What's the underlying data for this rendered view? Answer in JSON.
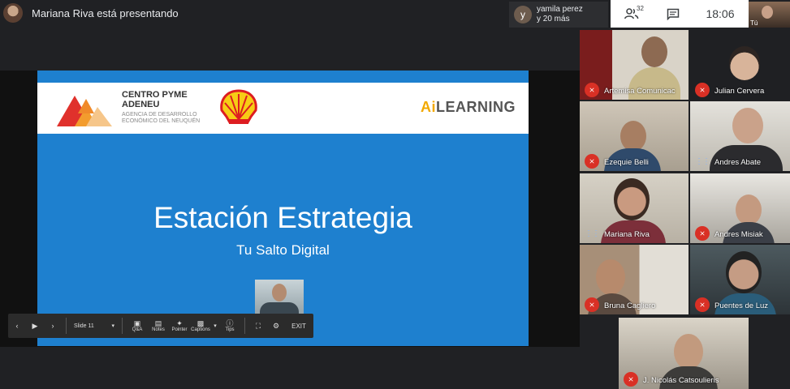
{
  "topbar": {
    "presenting_text": "Mariana Riva está presentando",
    "joiner_initial": "y",
    "joiner_line1": "yamila perez",
    "joiner_line2": "y 20 más",
    "people_count": "32",
    "time": "18:06",
    "self_label": "Tú"
  },
  "slide": {
    "org_title_line1": "CENTRO PYME",
    "org_title_line2": "ADENEU",
    "org_subtitle": "AGENCIA DE DESARROLLO ECONÓMICO DEL NEUQUÉN",
    "brand_ai": "Ai",
    "brand_learning": "LEARNING",
    "title": "Estación Estrategia",
    "subtitle": "Tu Salto Digital"
  },
  "slides_toolbar": {
    "slide_label": "Slide 11",
    "qa": "Q&A",
    "notes": "Notes",
    "pointer": "Pointer",
    "captions": "Captions",
    "tips": "Tips",
    "exit": "EXIT"
  },
  "participants": [
    {
      "name": "Artemisa Comunicac",
      "muted": true
    },
    {
      "name": "Julian Cervera",
      "muted": true
    },
    {
      "name": "Ezequie Belli",
      "muted": true
    },
    {
      "name": "Andres Abate",
      "muted": false
    },
    {
      "name": "Mariana Riva",
      "muted": false
    },
    {
      "name": "Andres Misiak",
      "muted": true
    },
    {
      "name": "Bruna Cagliero",
      "muted": true
    },
    {
      "name": "Puentes de Luz",
      "muted": true
    },
    {
      "name": "J. Nicolás Catsoulieris",
      "muted": true
    }
  ],
  "colors": {
    "slide_blue": "#1e80cf",
    "mute_red": "#d93025",
    "meet_dark": "#202124"
  },
  "icons": [
    "people-icon",
    "chat-icon",
    "mic-off-icon",
    "prev-icon",
    "play-icon",
    "next-icon",
    "fullscreen-icon",
    "settings-icon"
  ]
}
